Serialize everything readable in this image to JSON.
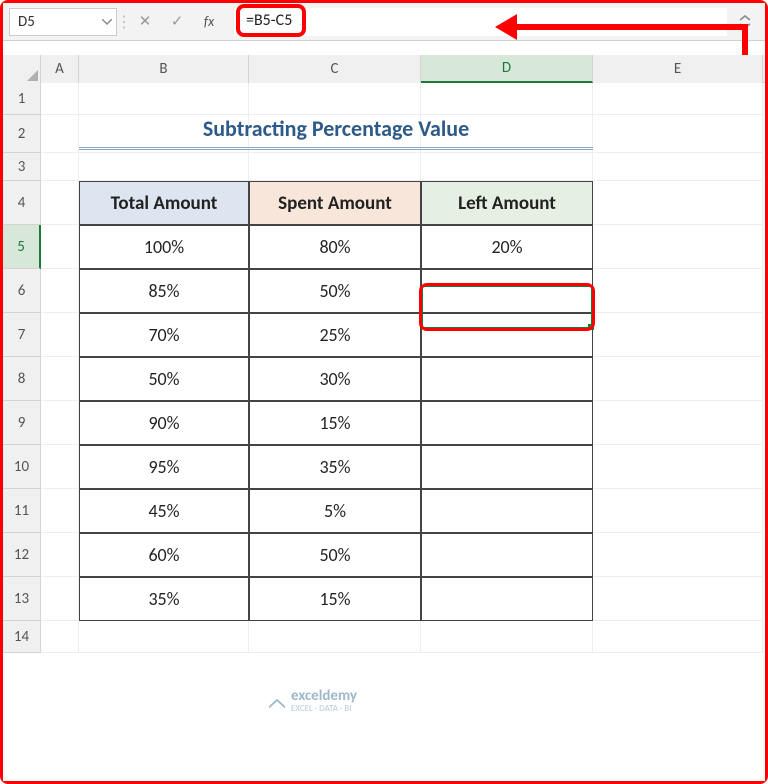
{
  "namebox": {
    "value": "D5"
  },
  "formula_bar": {
    "fx_label": "fx",
    "formula": "=B5-C5"
  },
  "column_headers": [
    "A",
    "B",
    "C",
    "D",
    "E"
  ],
  "row_headers": [
    "1",
    "2",
    "3",
    "4",
    "5",
    "6",
    "7",
    "8",
    "9",
    "10",
    "11",
    "12",
    "13",
    "14"
  ],
  "title": "Subtracting Percentage Value",
  "table": {
    "headers": {
      "b": "Total Amount",
      "c": "Spent Amount",
      "d": "Left Amount"
    },
    "rows": [
      {
        "b": "100%",
        "c": "80%",
        "d": "20%"
      },
      {
        "b": "85%",
        "c": "50%",
        "d": ""
      },
      {
        "b": "70%",
        "c": "25%",
        "d": ""
      },
      {
        "b": "50%",
        "c": "30%",
        "d": ""
      },
      {
        "b": "90%",
        "c": "15%",
        "d": ""
      },
      {
        "b": "95%",
        "c": "35%",
        "d": ""
      },
      {
        "b": "45%",
        "c": "5%",
        "d": ""
      },
      {
        "b": "60%",
        "c": "50%",
        "d": ""
      },
      {
        "b": "35%",
        "c": "15%",
        "d": ""
      }
    ]
  },
  "watermark": {
    "brand": "exceldemy",
    "tagline": "EXCEL · DATA · BI"
  },
  "selected_cell": "D5",
  "colors": {
    "annotation": "#ff0000",
    "excel_select": "#1a7a3a",
    "title": "#2e5a8a"
  }
}
